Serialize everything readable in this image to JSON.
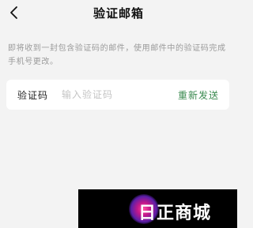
{
  "header": {
    "back_icon": "chevron-left-icon",
    "title": "验证邮箱"
  },
  "instructions": "即将收到一封包含验证码的邮件，使用邮件中的验证码完成手机号更改。",
  "code_row": {
    "label": "验证码",
    "input_value": "",
    "placeholder": "输入验证码",
    "resend_label": "重新发送",
    "accent_color": "#3a8a4f"
  },
  "watermark": {
    "text": "日正商城"
  }
}
